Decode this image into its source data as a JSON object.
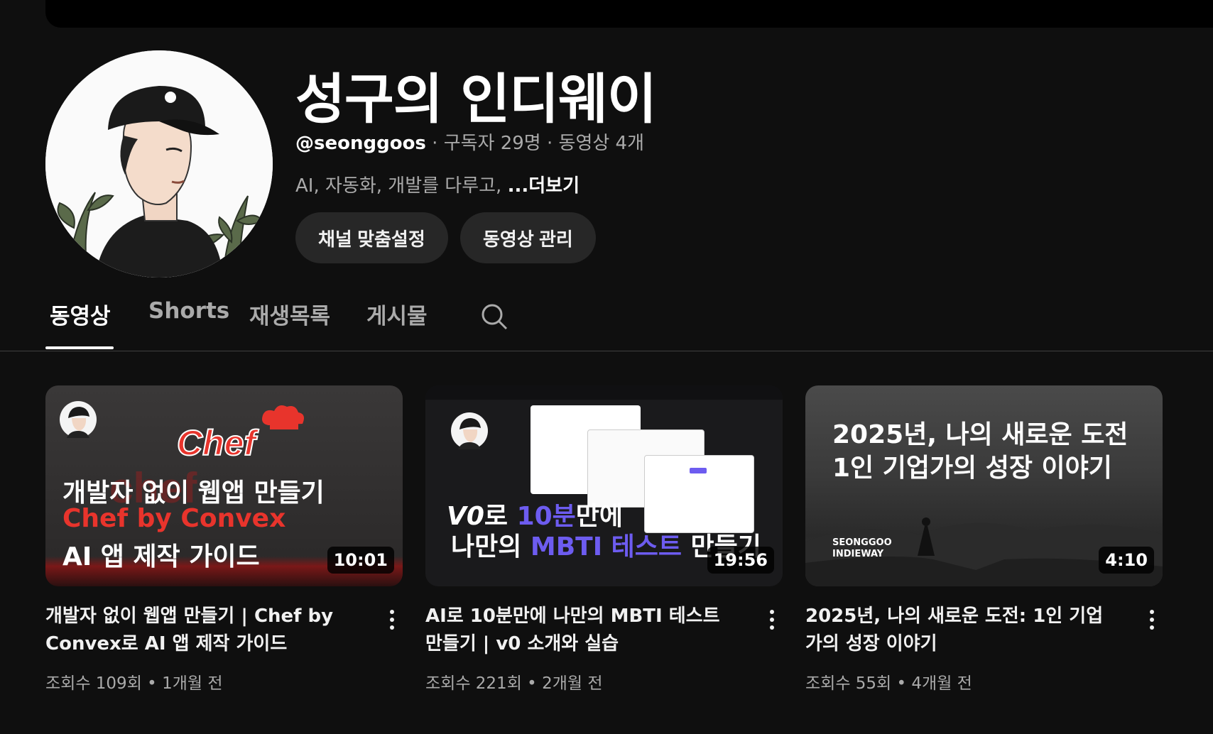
{
  "channel": {
    "title": "성구의 인디웨이",
    "handle": "@seonggoos",
    "subscribers": "· 구독자 29명",
    "videos_count": "· 동영상 4개",
    "description": "AI, 자동화, 개발를 다루고, ",
    "more": "...더보기",
    "customize_label": "채널 맞춤설정",
    "manage_label": "동영상 관리"
  },
  "tabs": [
    {
      "label": "동영상",
      "active": true
    },
    {
      "label": "Shorts",
      "active": false
    },
    {
      "label": "재생목록",
      "active": false
    },
    {
      "label": "게시물",
      "active": false
    }
  ],
  "videos": [
    {
      "title": "개발자 없이 웹앱 만들기 | Chef by Convex로 AI 앱 제작 가이드",
      "views": "조회수 109회",
      "age": "1개월 전",
      "duration": "10:01",
      "thumb": {
        "logo": "Chef",
        "line1": "개발자 없이 웹앱 만들기",
        "line2": "Chef by Convex",
        "line3": "AI 앱 제작 가이드"
      }
    },
    {
      "title": "AI로 10분만에 나만의 MBTI 테스트 만들기 | v0 소개와 실습",
      "views": "조회수 221회",
      "age": "2개월 전",
      "duration": "19:56",
      "thumb": {
        "logo": "V0",
        "line1a": "로 ",
        "line1b": "10분",
        "line1c": "만에",
        "line2a": "나만의 ",
        "line2b": "MBTI 테스트",
        "line2c": " 만들기"
      }
    },
    {
      "title": "2025년, 나의 새로운 도전: 1인 기업가의 성장 이야기",
      "views": "조회수 55회",
      "age": "4개월 전",
      "duration": "4:10",
      "thumb": {
        "line1": "2025년, 나의 새로운 도전",
        "line2": "1인 기업가의 성장 이야기",
        "brand1": "SEONGGOO",
        "brand2": "INDIEWAY"
      }
    }
  ],
  "meta_separator": " • ",
  "colors": {
    "background": "#0f0f0f",
    "chef_red": "#e8342c",
    "v0_purple": "#6d5cf0"
  }
}
